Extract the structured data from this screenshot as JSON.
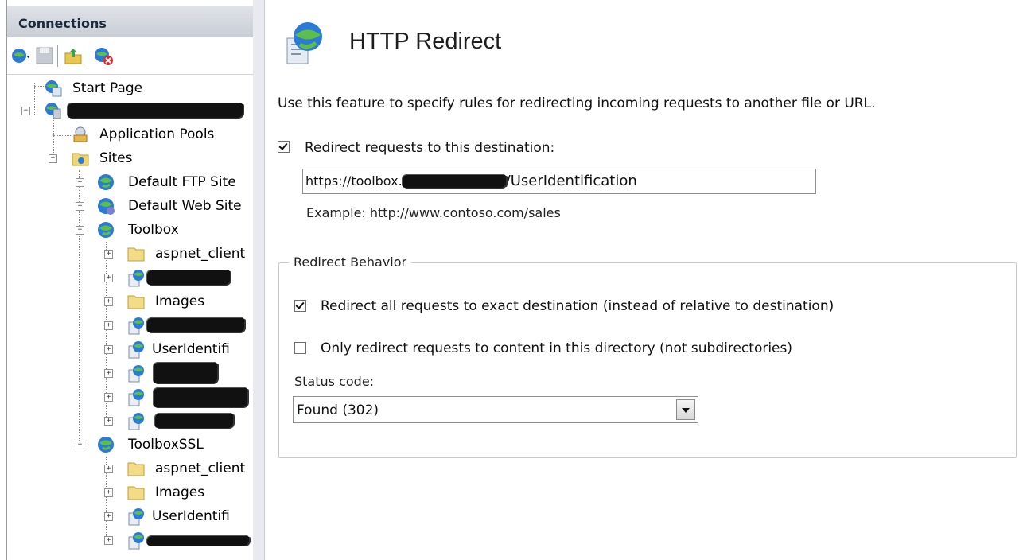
{
  "connections": {
    "title": "Connections",
    "toolbar": [
      "connect-icon",
      "save-icon",
      "up-icon",
      "disconnect-icon"
    ],
    "tree": [
      {
        "id": "start",
        "label": "Start Page",
        "icon": "start-page-icon"
      },
      {
        "id": "server",
        "label": "",
        "icon": "server-icon",
        "redacted": true
      },
      {
        "id": "apppools",
        "label": "Application Pools",
        "icon": "app-pools-icon"
      },
      {
        "id": "sites",
        "label": "Sites",
        "icon": "sites-folder-icon"
      },
      {
        "id": "ftp",
        "label": "Default FTP Site",
        "icon": "globe-icon"
      },
      {
        "id": "web",
        "label": "Default Web Site",
        "icon": "globe-icon"
      },
      {
        "id": "toolbox",
        "label": "Toolbox",
        "icon": "globe-icon"
      },
      {
        "id": "tb-aspnet",
        "label": "aspnet_client",
        "icon": "folder-icon"
      },
      {
        "id": "tb-app1",
        "label": "",
        "icon": "app-icon",
        "redacted": true
      },
      {
        "id": "tb-images",
        "label": "Images",
        "icon": "folder-icon"
      },
      {
        "id": "tb-app2",
        "label": "",
        "icon": "app-icon",
        "redacted": true
      },
      {
        "id": "tb-userid",
        "label": "UserIdentifi",
        "icon": "app-icon"
      },
      {
        "id": "tb-app3",
        "label": "",
        "icon": "app-icon",
        "redacted": true
      },
      {
        "id": "tb-app4",
        "label": "",
        "icon": "app-icon",
        "redacted": true
      },
      {
        "id": "tb-app5",
        "label": "",
        "icon": "app-icon",
        "redacted": true
      },
      {
        "id": "toolboxssl",
        "label": "ToolboxSSL",
        "icon": "globe-icon"
      },
      {
        "id": "ssl-aspnet",
        "label": "aspnet_client",
        "icon": "folder-icon"
      },
      {
        "id": "ssl-images",
        "label": "Images",
        "icon": "folder-icon"
      },
      {
        "id": "ssl-userid",
        "label": "UserIdentifi",
        "icon": "app-icon"
      },
      {
        "id": "ssl-app1",
        "label": "",
        "icon": "app-icon",
        "redacted": true
      }
    ]
  },
  "page": {
    "title": "HTTP Redirect",
    "icon": "http-redirect-icon",
    "description": "Use this feature to specify rules for redirecting incoming requests to another file or URL.",
    "redirect_checkbox": {
      "label": "Redirect requests to this destination:",
      "checked": true
    },
    "destination": {
      "prefix": "https://toolbox.",
      "suffix": "/UserIdentification"
    },
    "example": "Example: http://www.contoso.com/sales",
    "behavior": {
      "legend": "Redirect Behavior",
      "exact": {
        "label": "Redirect all requests to exact destination (instead of relative to destination)",
        "checked": true
      },
      "only_dir": {
        "label": "Only redirect requests to content in this directory (not subdirectories)",
        "checked": false
      },
      "status_label": "Status code:",
      "status_value": "Found (302)"
    }
  }
}
